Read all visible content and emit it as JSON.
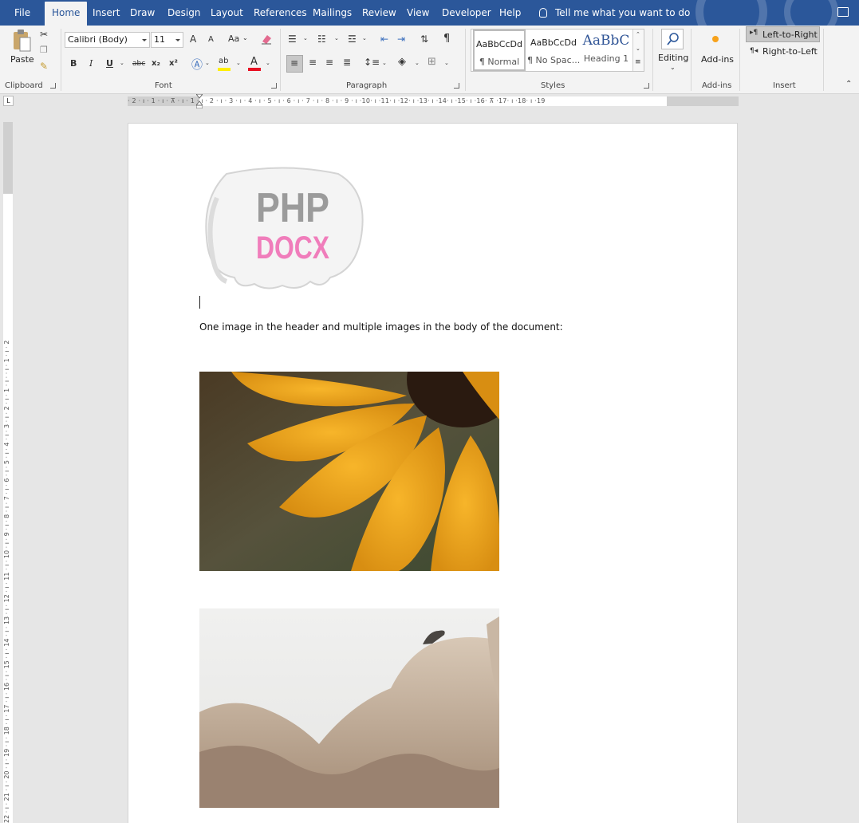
{
  "menu": {
    "tabs": [
      "File",
      "Home",
      "Insert",
      "Draw",
      "Design",
      "Layout",
      "References",
      "Mailings",
      "Review",
      "View",
      "Developer",
      "Help"
    ],
    "active": "Home",
    "tell_me": "Tell me what you want to do"
  },
  "ribbon": {
    "clipboard": {
      "paste": "Paste",
      "label": "Clipboard"
    },
    "font": {
      "name": "Calibri (Body)",
      "size": "11",
      "label": "Font",
      "grow": "A",
      "shrink": "A",
      "case": "Aa",
      "bold": "B",
      "italic": "I",
      "underline": "U",
      "strike": "abc",
      "subscript": "x₂",
      "superscript": "x²"
    },
    "paragraph": {
      "label": "Paragraph",
      "pilcrow": "¶"
    },
    "styles": {
      "label": "Styles",
      "items": [
        {
          "sample": "AaBbCcDd",
          "name": "¶ Normal"
        },
        {
          "sample": "AaBbCcDd",
          "name": "¶ No Spac..."
        },
        {
          "sample": "AaBbC",
          "name": "Heading 1"
        }
      ]
    },
    "editing": {
      "label": "Editing"
    },
    "addins": {
      "button": "Add-ins",
      "label": "Add-ins"
    },
    "insert": {
      "ltr": "Left-to-Right",
      "rtl": "Right-to-Left",
      "label": "Insert"
    }
  },
  "ruler": {
    "h": "· 2 · ı · 1 · ı · ⊼ · ı · 1 · ı · 2 · ı · 3 · ı · 4 · ı · 5 · ı · 6 · ı · 7 · ı · 8 · ı · 9 · ı ·10· ı ·11· ı ·12· ı ·13· ı ·14· ı ·15· ı ·16· ⊼ ·17· ı ·18· ı ·19",
    "v": "22 · ı · 21 · ı · 20 · ı · 19 · ı · 18 · ı · 17 · ı · 16 · ı · 15 · ı · 14 · ı · 13 · ı · 12 · ı · 11 · ı · 10 · ı · 9 · ı · 8 · ı · 7 · ı · 6 · ı · 5 · ı · 4 · ı · 3 · ı · 2 · ı · 1 · ı · · ı · 1 · ı · 2",
    "corner": "L"
  },
  "document": {
    "logo": {
      "line1": "PHP",
      "line2": "DOCX"
    },
    "body_text": "One image in the header and multiple images in the body of the document:"
  },
  "colors": {
    "menubar": "#2b579a",
    "ribbon": "#f3f3f3",
    "logo_grey": "#9b9b9b",
    "logo_pink": "#f07dbb"
  }
}
